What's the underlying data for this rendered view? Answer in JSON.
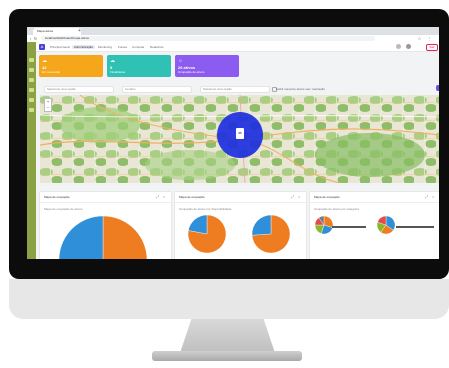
{
  "browser": {
    "tab_title": "Mapa ativos",
    "url": "localhost/dashboard/mapa-ativos"
  },
  "app": {
    "logo_letter": "A",
    "nav": [
      "Principal Geral",
      "Administração",
      "Monitoring",
      "Fontes",
      "Compras",
      "Relatórios"
    ],
    "user_label": "Sair"
  },
  "kpis": [
    {
      "icon": "☁",
      "value": "42",
      "label": "Em execução",
      "color": "#f5a61b"
    },
    {
      "icon": "☁",
      "value": "5",
      "label": "Finalizados",
      "color": "#2fc1b4"
    },
    {
      "icon": "☼",
      "value": "26 ativos",
      "label": "Ocupação de ativos",
      "color": "#8c5cf0"
    }
  ],
  "filters": {
    "select1": "Selecione uma opção",
    "select2": "Cenário",
    "select3": "Selecione uma opção",
    "toggle_label": "Exibir somente ativos sem marcação"
  },
  "map": {
    "cluster_count": "25",
    "zoom_in": "+",
    "zoom_out": "−"
  },
  "panels": [
    {
      "title": "Mapa de ocupação",
      "subtitle": "Mapa de ocupação de ativos"
    },
    {
      "title": "Mapa de ocupação",
      "subtitle": "Ocupação de ativos por disponibilidade"
    },
    {
      "title": "Mapa de ocupação",
      "subtitle": "Ocupação de ativos por categoria"
    }
  ],
  "chart_data": [
    {
      "type": "pie",
      "values": [
        52,
        48
      ],
      "colors": [
        "#ee7d21",
        "#2f8fd8"
      ]
    },
    {
      "type": "pie",
      "values": [
        78,
        22
      ],
      "colors": [
        "#ee7d21",
        "#2f8fd8"
      ]
    },
    {
      "type": "pie",
      "values": [
        74,
        26
      ],
      "colors": [
        "#ee7d21",
        "#2f8fd8"
      ]
    },
    {
      "type": "pie",
      "values": [
        30,
        25,
        20,
        15,
        10
      ],
      "colors": [
        "#ee7d21",
        "#2f8fd8",
        "#8ab82c",
        "#e24b4b",
        "#7a7a7a"
      ]
    },
    {
      "type": "pie",
      "values": [
        35,
        25,
        20,
        20
      ],
      "colors": [
        "#2f8fd8",
        "#ee7d21",
        "#8ab82c",
        "#e24b4b"
      ]
    }
  ]
}
